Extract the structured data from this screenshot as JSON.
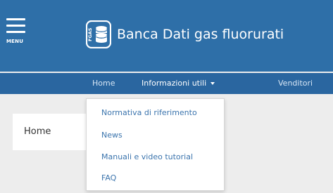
{
  "header": {
    "menu_label": "MENU",
    "logo_text": "FGAS",
    "title": "Banca Dati gas fluorurati"
  },
  "nav": {
    "items": [
      {
        "label": "Home"
      },
      {
        "label": "Informazioni utili"
      },
      {
        "label": "Venditori"
      }
    ]
  },
  "breadcrumb": {
    "home_label": "Home"
  },
  "dropdown": {
    "items": [
      {
        "label": "Normativa di riferimento"
      },
      {
        "label": "News"
      },
      {
        "label": "Manuali e video tutorial"
      },
      {
        "label": "FAQ"
      }
    ]
  },
  "colors": {
    "brand_blue": "#2e6fa8",
    "nav_blue": "#2a66a0",
    "link_blue": "#3b74ad",
    "background": "#ededed"
  },
  "icons": {
    "menu": "hamburger-icon",
    "logo": "database-icon",
    "dropdown_caret": "caret-down-icon"
  }
}
